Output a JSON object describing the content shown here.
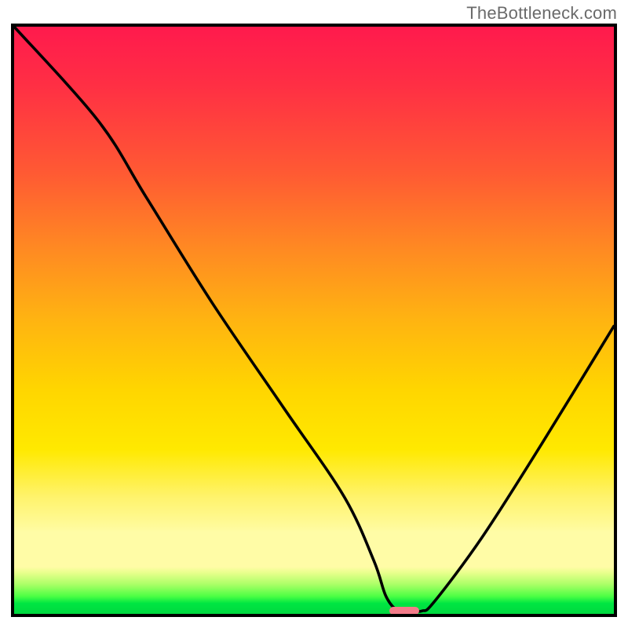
{
  "watermark": "TheBottleneck.com",
  "chart_data": {
    "type": "line",
    "title": "",
    "xlabel": "",
    "ylabel": "",
    "xlim": [
      0,
      100
    ],
    "ylim": [
      0,
      100
    ],
    "series": [
      {
        "name": "curve",
        "x": [
          0,
          14,
          22,
          33,
          45,
          55,
          60,
          62,
          64,
          66,
          68,
          70,
          78,
          88,
          100
        ],
        "values": [
          100,
          84,
          71,
          53,
          35,
          20,
          9,
          3,
          0.5,
          0.5,
          0.5,
          2,
          13,
          29,
          49
        ]
      }
    ],
    "marker": {
      "x": 65,
      "y": 0.5,
      "width_pct": 5,
      "color": "#f47c8a"
    },
    "background_gradient": {
      "type": "vertical",
      "stops": [
        {
          "pos": 0,
          "color": "#ff1a4d"
        },
        {
          "pos": 0.5,
          "color": "#ffd600"
        },
        {
          "pos": 0.88,
          "color": "#fffca6"
        },
        {
          "pos": 1.0,
          "color": "#00d93f"
        }
      ]
    },
    "grid": false,
    "legend": {
      "visible": false
    }
  }
}
